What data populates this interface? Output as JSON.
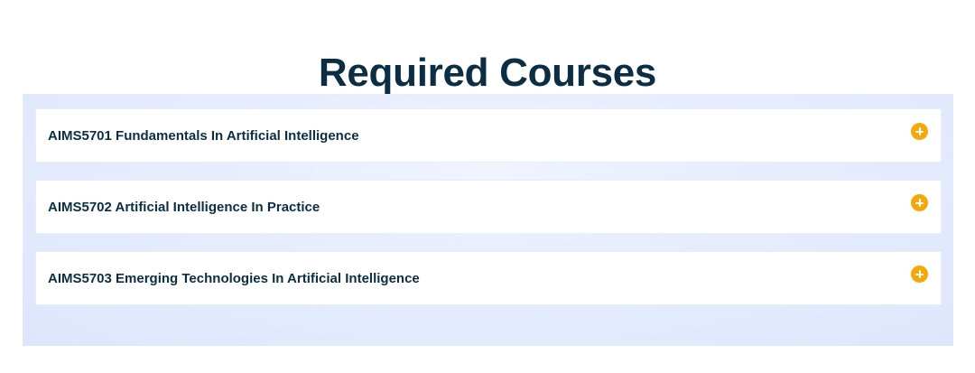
{
  "page": {
    "title": "Required Courses"
  },
  "courses": [
    {
      "label": "AIMS5701 Fundamentals In Artificial Intelligence",
      "icon": "plus-circle-icon"
    },
    {
      "label": "AIMS5702 Artificial Intelligence In Practice",
      "icon": "plus-circle-icon"
    },
    {
      "label": "AIMS5703 Emerging Technologies In Artificial Intelligence",
      "icon": "plus-circle-icon"
    }
  ],
  "colors": {
    "heading": "#0b2e45",
    "accent": "#f5a80a",
    "panel_background": "#e6edfe"
  }
}
